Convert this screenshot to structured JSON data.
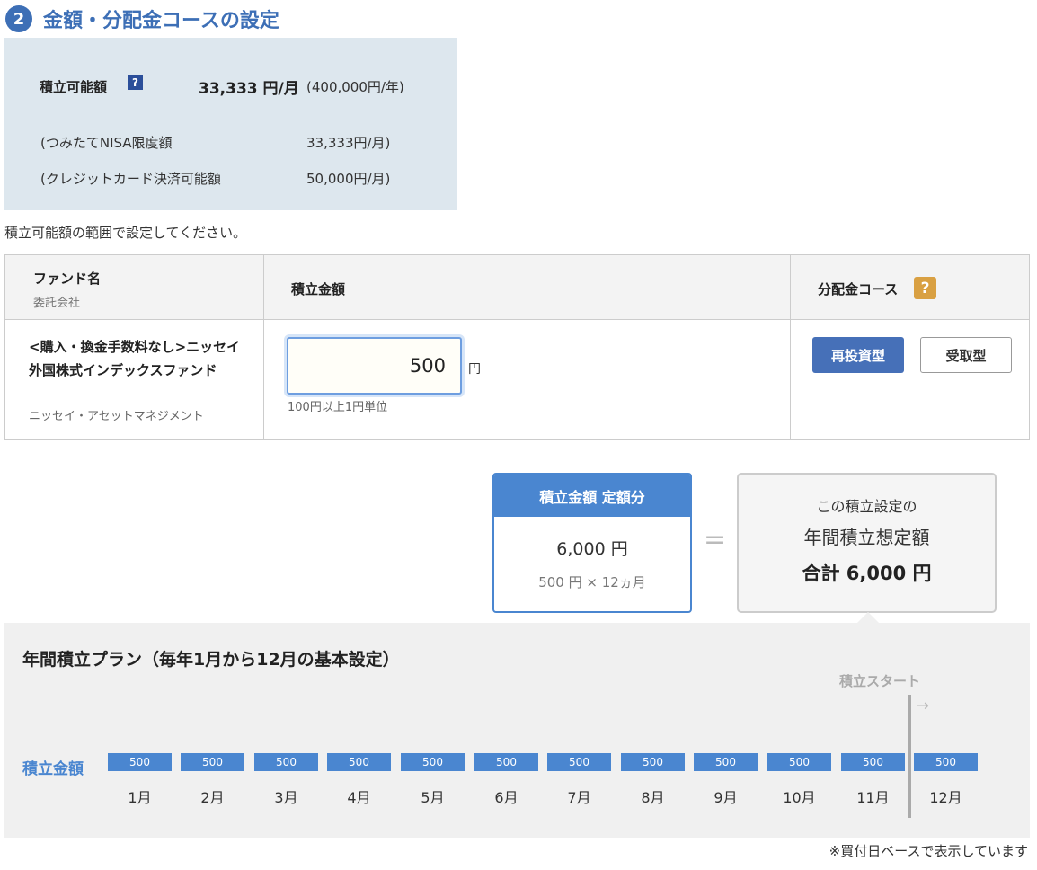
{
  "section": {
    "number": "2",
    "title": "金額・分配金コースの設定"
  },
  "limit": {
    "label": "積立可能額",
    "help_icon": "question-icon",
    "monthly": "33,333 円/月",
    "yearly": "(400,000円/年)",
    "nisa_label": "(つみたてNISA限度額",
    "nisa_value": "33,333円/月)",
    "card_label": "(クレジットカード決済可能額",
    "card_value": "50,000円/月)"
  },
  "instruction": "積立可能額の範囲で設定してください。",
  "table": {
    "header": {
      "fund": "ファンド名",
      "company": "委託会社",
      "amount": "積立金額",
      "course": "分配金コース",
      "course_help": "?"
    },
    "row": {
      "fund_name": "<購入・換金手数料なし>ニッセイ 外国株式インデックスファンド",
      "company": "ニッセイ・アセットマネジメント",
      "amount_value": "500",
      "unit": "円",
      "amount_note": "100円以上1円単位",
      "course_options": [
        "再投資型",
        "受取型"
      ],
      "course_selected": "再投資型"
    }
  },
  "summary": {
    "fixed_title": "積立金額 定額分",
    "fixed_amount": "6,000 円",
    "fixed_calc": "500 円 × 12ヵ月",
    "equals": "=",
    "total_line1": "この積立設定の",
    "total_line2": "年間積立想定額",
    "total_line3": "合計 6,000 円"
  },
  "plan": {
    "title": "年間積立プラン（毎年1月から12月の基本設定）",
    "start_label": "積立スタート",
    "start_arrow": "→",
    "row_label": "積立金額",
    "months": [
      {
        "month": "1月",
        "amount": "500"
      },
      {
        "month": "2月",
        "amount": "500"
      },
      {
        "month": "3月",
        "amount": "500"
      },
      {
        "month": "4月",
        "amount": "500"
      },
      {
        "month": "5月",
        "amount": "500"
      },
      {
        "month": "6月",
        "amount": "500"
      },
      {
        "month": "7月",
        "amount": "500"
      },
      {
        "month": "8月",
        "amount": "500"
      },
      {
        "month": "9月",
        "amount": "500"
      },
      {
        "month": "10月",
        "amount": "500"
      },
      {
        "month": "11月",
        "amount": "500"
      },
      {
        "month": "12月",
        "amount": "500"
      }
    ]
  },
  "footnote": "※買付日ベースで表示しています",
  "colors": {
    "accent": "#3d6fb6",
    "bar": "#4a86d0",
    "help": "#d9a042",
    "panel": "#dde7ee"
  }
}
